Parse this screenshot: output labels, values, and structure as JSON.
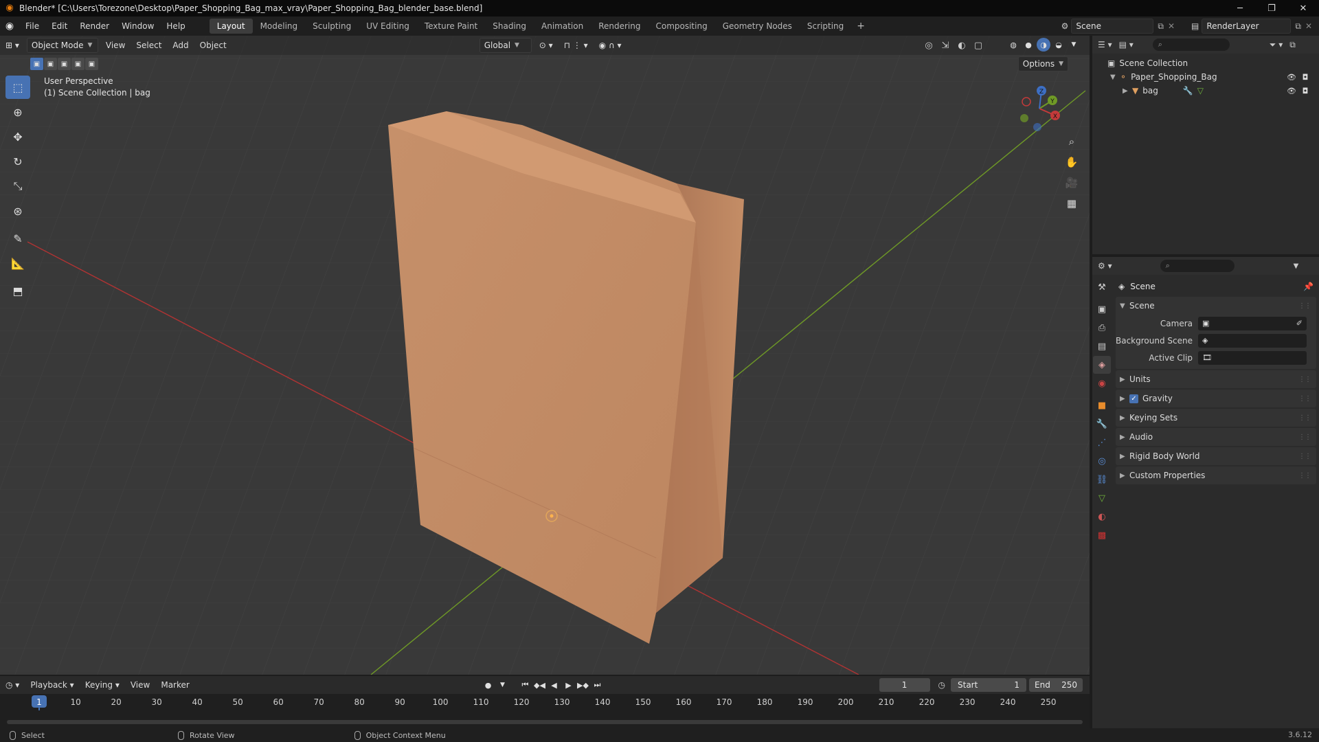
{
  "window": {
    "title": "Blender* [C:\\Users\\Torezone\\Desktop\\Paper_Shopping_Bag_max_vray\\Paper_Shopping_Bag_blender_base.blend]",
    "minimize": "─",
    "maximize": "❐",
    "close": "✕"
  },
  "menus": [
    "File",
    "Edit",
    "Render",
    "Window",
    "Help"
  ],
  "workspaces": [
    "Layout",
    "Modeling",
    "Sculpting",
    "UV Editing",
    "Texture Paint",
    "Shading",
    "Animation",
    "Rendering",
    "Compositing",
    "Geometry Nodes",
    "Scripting"
  ],
  "workspace_add": "+",
  "scene_selector": {
    "value": "Scene"
  },
  "view_layer": {
    "value": "RenderLayer"
  },
  "viewport": {
    "mode": "Object Mode",
    "menus": [
      "View",
      "Select",
      "Add",
      "Object"
    ],
    "orientation": "Global",
    "options_label": "Options",
    "info_line1": "User Perspective",
    "info_line2": "(1) Scene Collection | bag",
    "gizmo_labels": {
      "x": "X",
      "y": "Y",
      "z": "Z"
    }
  },
  "outliner": {
    "search_placeholder": "",
    "rows": [
      {
        "label": "Scene Collection",
        "depth": 0
      },
      {
        "label": "Paper_Shopping_Bag",
        "depth": 1
      },
      {
        "label": "bag",
        "depth": 2
      }
    ]
  },
  "properties": {
    "search_placeholder": "",
    "context_title": "Scene",
    "scene_panel_title": "Scene",
    "rows": [
      {
        "label": "Camera",
        "value": ""
      },
      {
        "label": "Background Scene",
        "value": ""
      },
      {
        "label": "Active Clip",
        "value": ""
      }
    ],
    "collapsed_panels": [
      "Units",
      "Gravity",
      "Keying Sets",
      "Audio",
      "Rigid Body World",
      "Custom Properties"
    ],
    "gravity_checked": true
  },
  "timeline": {
    "menus": [
      "Playback",
      "Keying",
      "View",
      "Marker"
    ],
    "current_frame": "1",
    "start_label": "Start",
    "start_value": "1",
    "end_label": "End",
    "end_value": "250",
    "ticks": [
      "1",
      "10",
      "20",
      "30",
      "40",
      "50",
      "60",
      "70",
      "80",
      "90",
      "100",
      "110",
      "120",
      "130",
      "140",
      "150",
      "160",
      "170",
      "180",
      "190",
      "200",
      "210",
      "220",
      "230",
      "240",
      "250"
    ]
  },
  "statusbar": {
    "items": [
      "Select",
      "Rotate View",
      "Object Context Menu"
    ],
    "version": "3.6.12"
  },
  "colors": {
    "accent": "#4772b3",
    "bag": "#c08a62",
    "x_axis": "#b03333",
    "y_axis": "#6f9a26"
  }
}
